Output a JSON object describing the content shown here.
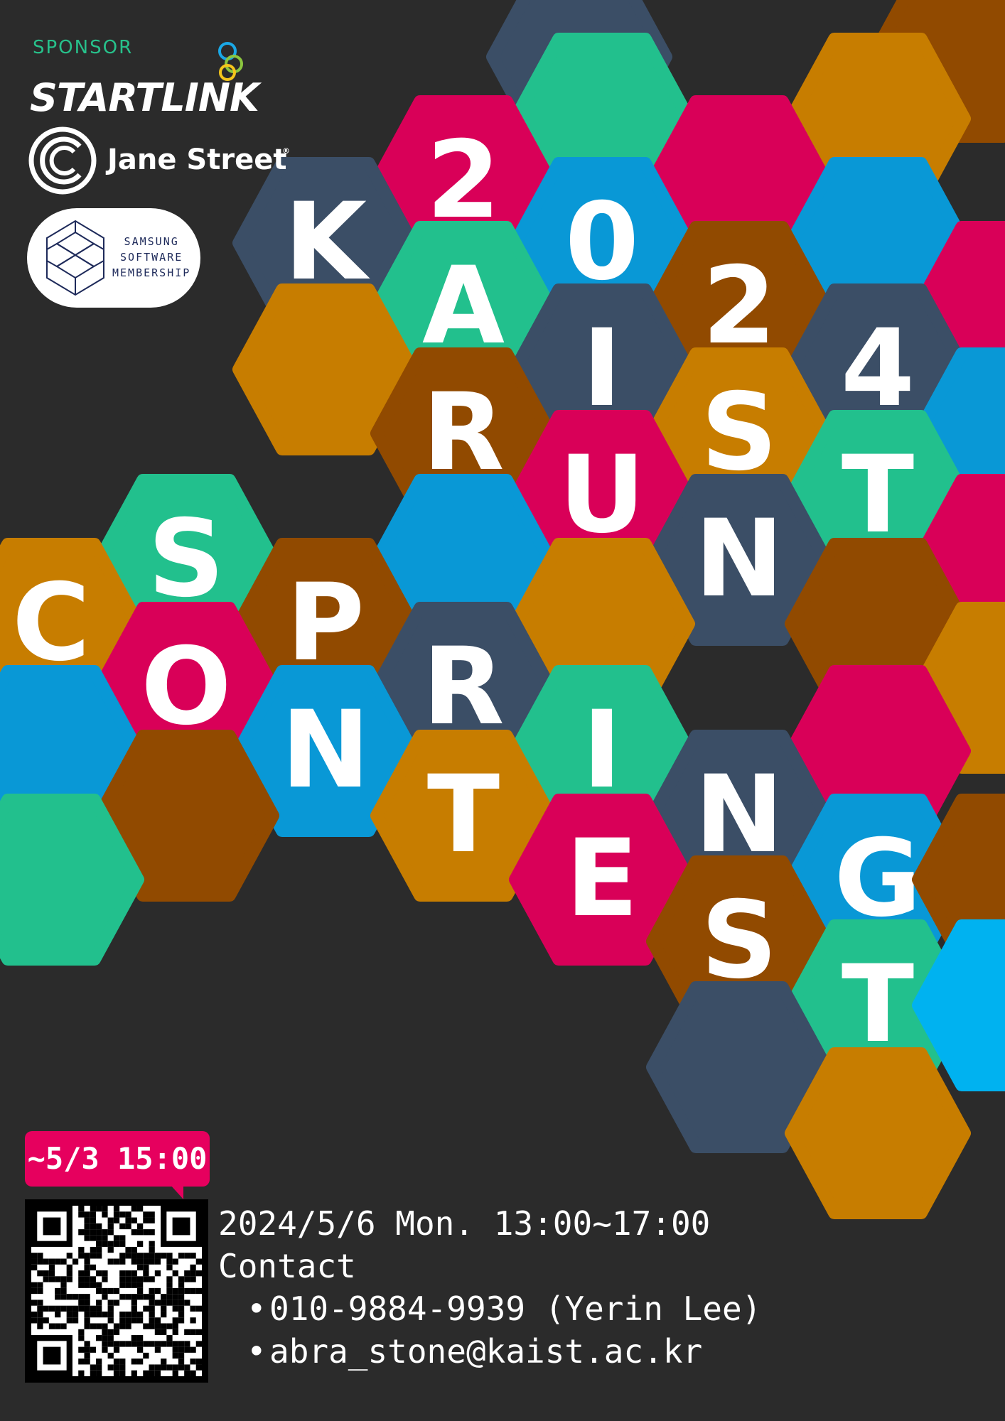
{
  "poster": {
    "title_hexes": [
      "K",
      "2",
      "A",
      "0",
      "I",
      "2",
      "R",
      "4",
      "S",
      "U",
      "T",
      "N",
      "S",
      "C",
      "P",
      "O",
      "R",
      "N",
      "I",
      "T",
      "N",
      "G",
      "E",
      "S",
      "T"
    ],
    "colors": {
      "background": "#2b2b2b",
      "slate": "#3b4e66",
      "green": "#22c08d",
      "magenta": "#d90058",
      "blue": "#0998d6",
      "brown": "#914a00",
      "amber": "#c77d00",
      "sky": "#00b2f0",
      "sponsor_label": "#27c18b",
      "badge": "#e6005e"
    }
  },
  "sponsors": {
    "label": "SPONSOR",
    "startlink": "STARTLINK",
    "jane_street": "Jane Street",
    "jane_street_mark": "®",
    "samsung_lines": [
      "SAMSUNG",
      "SOFTWARE",
      "MEMBERSHIP"
    ]
  },
  "registration": {
    "deadline": "~5/3 15:00",
    "qr_icon": "qr-code-icon"
  },
  "event": {
    "datetime": "2024/5/6 Mon. 13:00~17:00",
    "contact_label": "Contact",
    "contacts": [
      "010-9884-9939 (Yerin Lee)",
      "abra_stone@kaist.ac.kr"
    ]
  }
}
